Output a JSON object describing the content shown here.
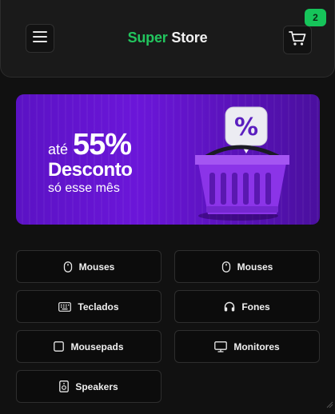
{
  "header": {
    "brand_first": "Super",
    "brand_second": "Store",
    "menu_icon": "hamburger-menu-icon",
    "cart_icon": "shopping-cart-icon",
    "cart_count": "2",
    "accent_color": "#22c55e"
  },
  "banner": {
    "prefix": "até",
    "discount": "55%",
    "title": "Desconto",
    "subtitle": "só esse mês",
    "badge_symbol": "%",
    "background_color": "#6b16d9"
  },
  "categories": [
    {
      "label": "Mouses",
      "icon": "mouse-icon"
    },
    {
      "label": "Mouses",
      "icon": "mouse-icon"
    },
    {
      "label": "Teclados",
      "icon": "keyboard-icon"
    },
    {
      "label": "Fones",
      "icon": "headphones-icon"
    },
    {
      "label": "Mousepads",
      "icon": "mousepad-icon"
    },
    {
      "label": "Monitores",
      "icon": "monitor-icon"
    },
    {
      "label": "Speakers",
      "icon": "speaker-icon"
    }
  ]
}
